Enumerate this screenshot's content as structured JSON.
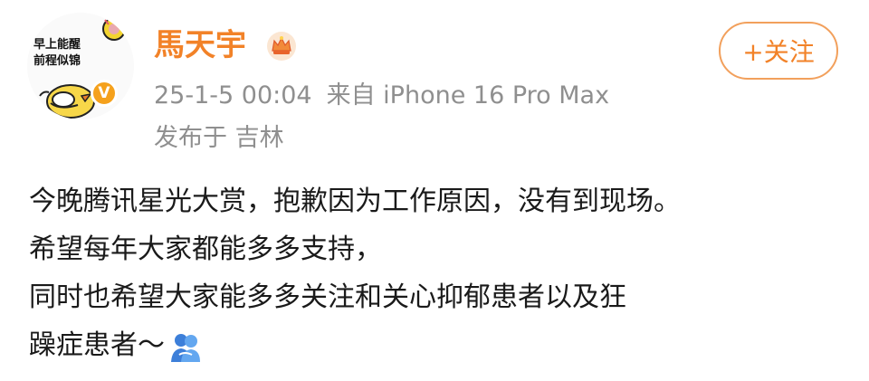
{
  "user": {
    "name": "馬天宇",
    "avatar_text_line1": "早上能醒",
    "avatar_text_line2": "前程似锦",
    "verified_badge": "V",
    "colors": {
      "name": "#f28228",
      "badge": "#f5a11c"
    }
  },
  "post_meta": {
    "date": "25-1-5 00:04",
    "source": "来自 iPhone 16 Pro Max",
    "location": "发布于 吉林"
  },
  "follow_button": {
    "label": "+关注"
  },
  "post": {
    "lines": [
      "今晚腾讯星光大赏，抱歉因为工作原因，没有到现场。",
      "希望每年大家都能多多支持，",
      "同时也希望大家能多多关注和关心抑郁患者以及狂",
      "躁症患者～"
    ],
    "trailing_icon": "hug-emoji-icon"
  }
}
